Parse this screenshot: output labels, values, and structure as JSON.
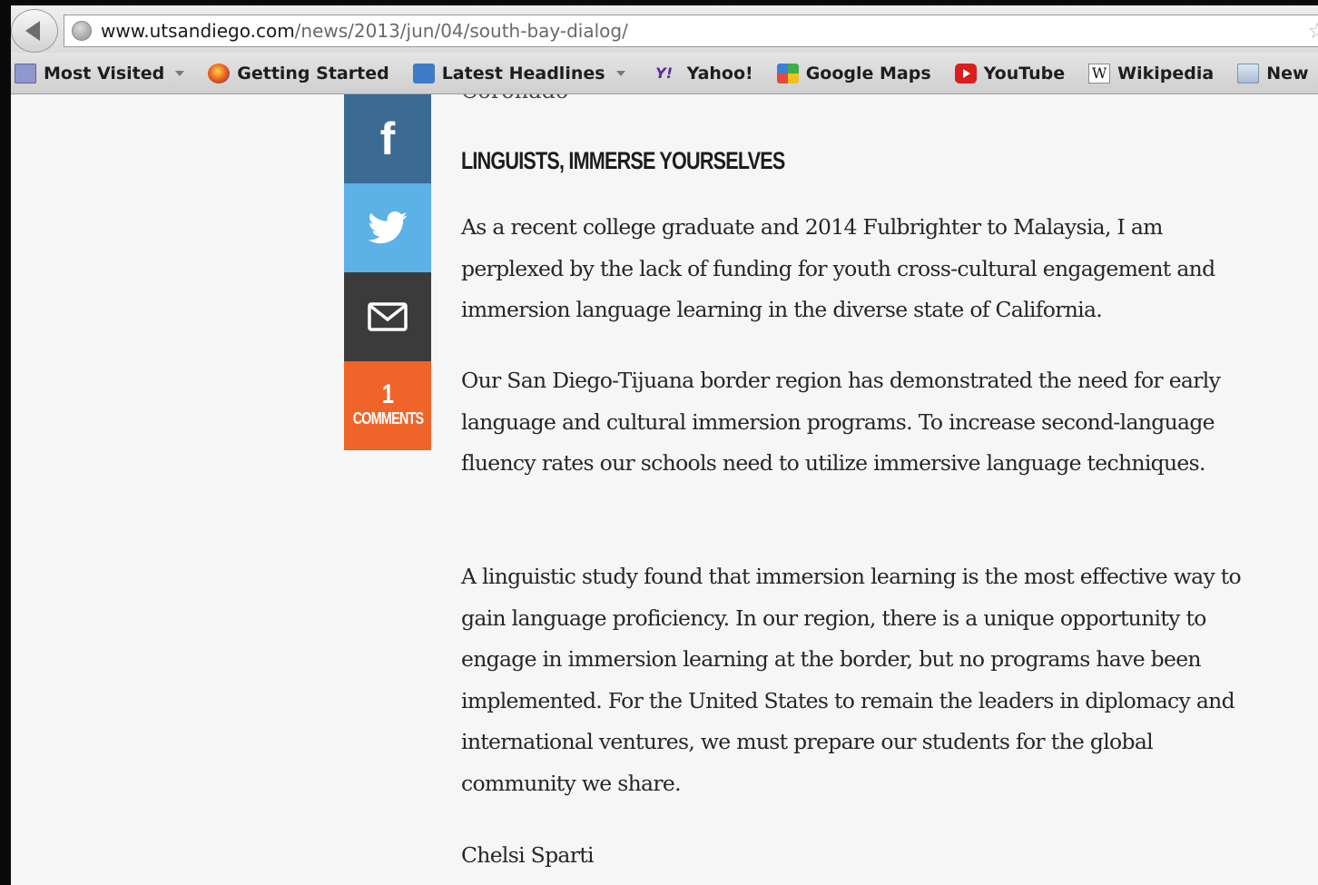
{
  "browser": {
    "url_host": "www.utsandiego.com",
    "url_path": "/news/2013/jun/04/south-bay-dialog/",
    "bookmarks": [
      {
        "label": "Most Visited",
        "icon": "folder-star-icon",
        "dropdown": true
      },
      {
        "label": "Getting Started",
        "icon": "firefox-icon",
        "dropdown": false
      },
      {
        "label": "Latest Headlines",
        "icon": "rss-icon",
        "dropdown": true
      },
      {
        "label": "Yahoo!",
        "icon": "yahoo-icon",
        "dropdown": false
      },
      {
        "label": "Google Maps",
        "icon": "google-maps-icon",
        "dropdown": false
      },
      {
        "label": "YouTube",
        "icon": "youtube-icon",
        "dropdown": false
      },
      {
        "label": "Wikipedia",
        "icon": "wikipedia-icon",
        "dropdown": false
      },
      {
        "label": "New",
        "icon": "folder-icon",
        "dropdown": false
      }
    ]
  },
  "share": {
    "facebook_glyph": "f",
    "comment_count": "1",
    "comment_label": "COMMENTS",
    "colors": {
      "facebook": "#3b6b92",
      "twitter": "#5cb2e7",
      "email": "#3b3b3b",
      "comments": "#f0642a"
    }
  },
  "article": {
    "cut_off_text": "Coronado",
    "heading": "LINGUISTS, IMMERSE YOURSELVES",
    "paragraphs": [
      "As a recent college graduate and 2014 Fulbrighter to Malaysia, I am perplexed by the lack of funding for youth cross-cultural engagement and immersion language learning in the diverse state of California.",
      "Our San Diego-Tijuana border region has demonstrated the need for early language and cultural immersion programs. To increase second-language fluency rates our schools need to utilize immersive language techniques.",
      "A linguistic study found that immersion learning is the most effective way to gain language proficiency. In our region, there is a unique opportunity to engage in immersion learning at the border, but no programs have been implemented. For the United States to remain the leaders in diplomacy and international ventures, we must prepare our students for the global community we share."
    ],
    "signature": "Chelsi Sparti"
  }
}
